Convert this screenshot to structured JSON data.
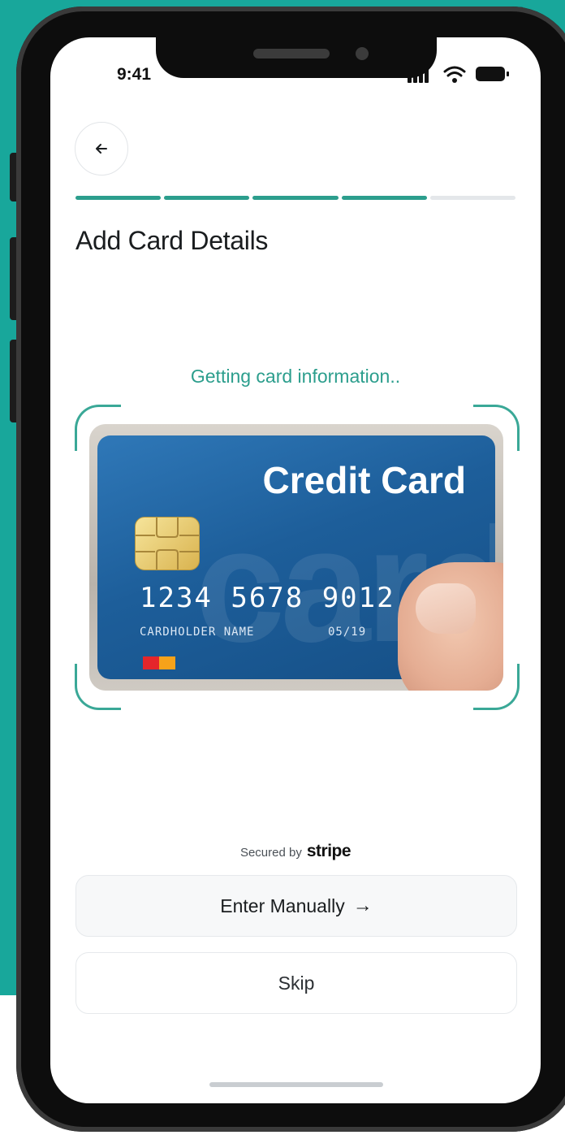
{
  "status_bar": {
    "time": "9:41"
  },
  "header": {
    "back_icon": "arrow-left-icon",
    "progress": {
      "steps_total": 5,
      "steps_completed": 4
    },
    "title": "Add Card Details"
  },
  "scanner": {
    "status_text": "Getting card information..",
    "card": {
      "title": "Credit Card",
      "background_word": "card",
      "number": "1234 5678 9012 3456",
      "holder": "CARDHOLDER NAME",
      "expiry": "05/19"
    }
  },
  "footer": {
    "secured_label": "Secured by",
    "secured_brand": "stripe",
    "enter_manually_label": "Enter Manually",
    "enter_manually_icon": "arrow-right-icon",
    "skip_label": "Skip"
  },
  "colors": {
    "accent": "#2c9e8d",
    "background": "#18a79b",
    "card": "#1d5e9a"
  }
}
